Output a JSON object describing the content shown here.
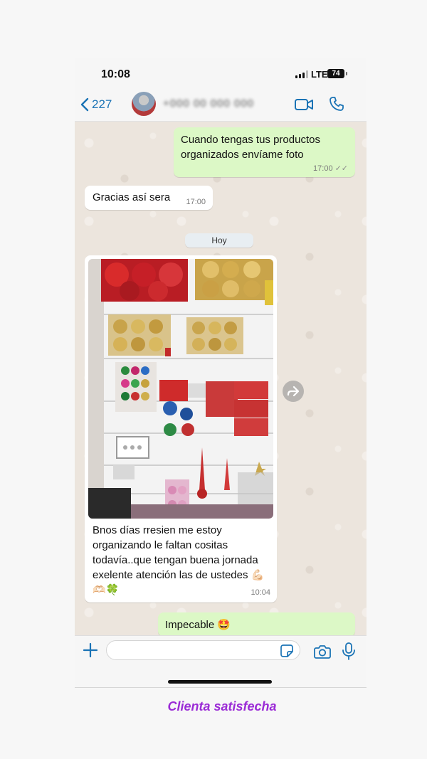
{
  "status_bar": {
    "time": "10:08",
    "network": "LTE",
    "battery": "74"
  },
  "header": {
    "back_count": "227",
    "contact_name": "+000 00 000 000",
    "icons": {
      "back": "chevron-left-icon",
      "video": "video-camera-icon",
      "call": "phone-icon"
    }
  },
  "chat": {
    "messages": [
      {
        "direction": "outgoing",
        "text": "Cuando tengas tus productos organizados envíame foto",
        "time": "17:00",
        "status": "read-double-check"
      },
      {
        "direction": "incoming",
        "text": "Gracias así sera",
        "time": "17:00"
      },
      {
        "direction": "incoming",
        "type": "image-with-caption",
        "image": "photo of Christmas ornaments displayed on a slatwall",
        "text": "Bnos días rresien me estoy organizando le faltan cositas todavía..que tengan buena jornada exelente atención las de ustedes 💪🏻🫶🏻🍀",
        "time": "10:04"
      },
      {
        "direction": "outgoing",
        "text": "Impecable 🤩"
      }
    ],
    "date_separator": "Hoy"
  },
  "input_bar": {
    "placeholder": "",
    "icons": {
      "add": "plus-icon",
      "sticker": "sticker-icon",
      "camera": "camera-icon",
      "mic": "microphone-icon"
    }
  },
  "caption": "Clienta satisfecha",
  "colors": {
    "outgoing_bubble": "#dcf8c6",
    "incoming_bubble": "#ffffff",
    "chat_background": "#ece5dd",
    "accent": "#1a73b5",
    "caption": "#9b2bd6"
  }
}
